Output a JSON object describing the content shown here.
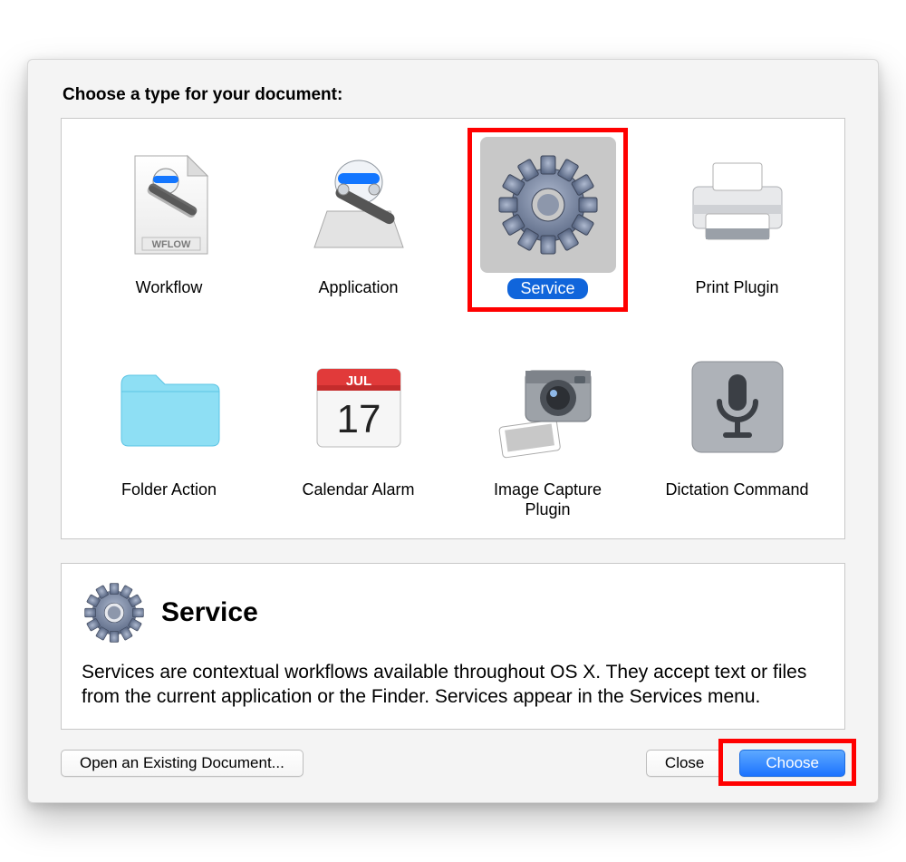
{
  "header": "Choose a type for your document:",
  "types": [
    {
      "id": "workflow",
      "label": "Workflow"
    },
    {
      "id": "application",
      "label": "Application"
    },
    {
      "id": "service",
      "label": "Service",
      "selected": true
    },
    {
      "id": "print-plugin",
      "label": "Print Plugin"
    },
    {
      "id": "folder-action",
      "label": "Folder Action"
    },
    {
      "id": "calendar-alarm",
      "label": "Calendar Alarm"
    },
    {
      "id": "image-capture-plugin",
      "label": "Image Capture Plugin"
    },
    {
      "id": "dictation-command",
      "label": "Dictation Command"
    }
  ],
  "calendar": {
    "month": "JUL",
    "day": "17"
  },
  "wflow_badge": "WFLOW",
  "description": {
    "title": "Service",
    "body": "Services are contextual workflows available throughout OS X. They accept text or files from the current application or the Finder. Services appear in the Services menu."
  },
  "footer": {
    "open_existing": "Open an Existing Document...",
    "close": "Close",
    "choose": "Choose"
  }
}
